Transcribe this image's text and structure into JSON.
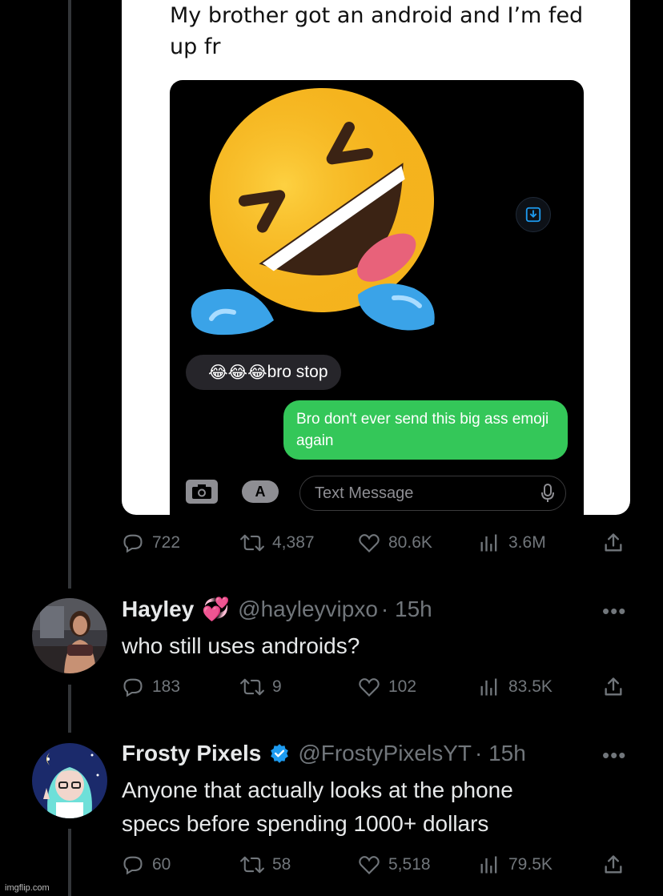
{
  "post": {
    "caption": "My brother got an android and I’m fed up fr",
    "messages": {
      "received_emojis": "😂😂😂",
      "received_text": "bro stop",
      "sent": "Bro don't ever send this big ass emoji again"
    },
    "composer_placeholder": "Text Message",
    "big_emoji": "rolling-on-floor-laughing",
    "stats": {
      "replies": "722",
      "reposts": "4,387",
      "likes": "80.6K",
      "views": "3.6M"
    }
  },
  "replies": [
    {
      "name": "Hayley",
      "badge": "💞",
      "handle": "@hayleyvipxo",
      "time": "· 15h",
      "text": "who still uses androids?",
      "stats": {
        "replies": "183",
        "reposts": "9",
        "likes": "102",
        "views": "83.5K"
      }
    },
    {
      "name": "Frosty Pixels",
      "verified": true,
      "handle": "@FrostyPixelsYT",
      "time": "· 15h",
      "text_line1": "Anyone that actually looks at the phone",
      "text_line2": "specs before spending 1000+ dollars",
      "stats": {
        "replies": "60",
        "reposts": "58",
        "likes": "5,518",
        "views": "79.5K"
      }
    }
  ],
  "more_label": "•••",
  "watermark": "imgflip.com",
  "colors": {
    "background": "#000000",
    "muted": "#71767b",
    "imessage_green": "#34c759",
    "verified_blue": "#1d9bf0"
  }
}
